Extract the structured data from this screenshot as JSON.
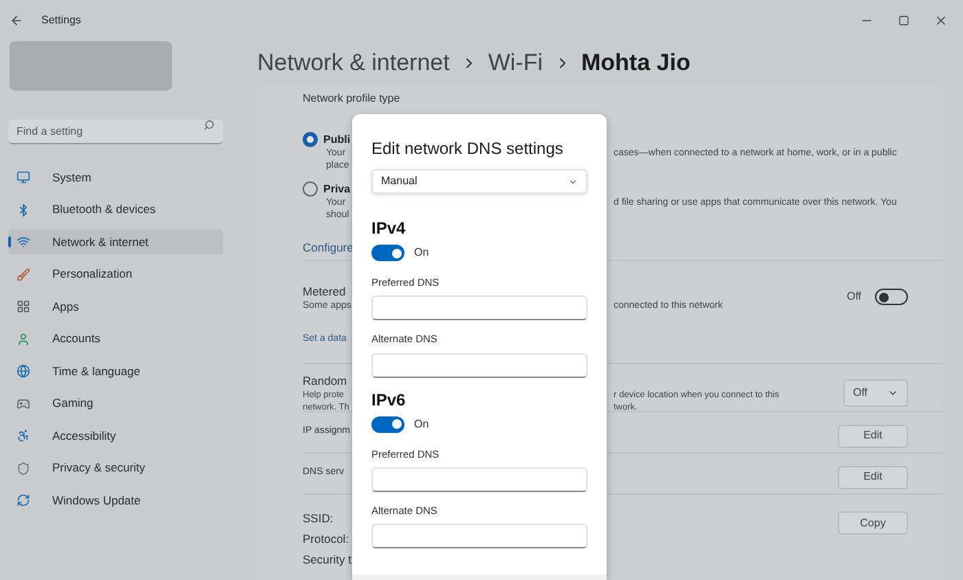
{
  "window": {
    "title": "Settings"
  },
  "breadcrumb": [
    {
      "label": "Network & internet",
      "current": false
    },
    {
      "label": "Wi-Fi",
      "current": false
    },
    {
      "label": "Mohta Jio",
      "current": true
    }
  ],
  "search": {
    "placeholder": "Find a setting"
  },
  "sidebar": {
    "items": [
      {
        "label": "System",
        "selected": false
      },
      {
        "label": "Bluetooth & devices",
        "selected": false
      },
      {
        "label": "Network & internet",
        "selected": true
      },
      {
        "label": "Personalization",
        "selected": false
      },
      {
        "label": "Apps",
        "selected": false
      },
      {
        "label": "Accounts",
        "selected": false
      },
      {
        "label": "Time & language",
        "selected": false
      },
      {
        "label": "Gaming",
        "selected": false
      },
      {
        "label": "Accessibility",
        "selected": false
      },
      {
        "label": "Privacy & security",
        "selected": false
      },
      {
        "label": "Windows Update",
        "selected": false
      }
    ]
  },
  "profile_section": {
    "heading": "Network profile type",
    "options": [
      {
        "label": "Publi",
        "line_1": "Your",
        "line_1_rest": "cases—when connected to a network at home, work, or in a public",
        "line_2": "place",
        "selected": true
      },
      {
        "label": "Priva",
        "line_1": "Your",
        "line_1_rest": "d file sharing or use apps that communicate over this network. You",
        "line_2": "shoul",
        "selected": false
      }
    ],
    "link": "Configure"
  },
  "metered": {
    "title": "Metered",
    "description": "Some apps",
    "description_rest": "connected to this network",
    "link": "Set a data",
    "toggle_label": "Off",
    "on": false
  },
  "random": {
    "title": "Random",
    "line_1": "Help prote",
    "line_1_rest": "r device location when you connect to this",
    "line_2": "network. Th",
    "line_2_rest": "twork.",
    "value": "Off"
  },
  "ip_assignment": {
    "title": "IP assignm",
    "button": "Edit"
  },
  "dns_server": {
    "title": "DNS serv",
    "button": "Edit"
  },
  "properties": {
    "labels": [
      "SSID:",
      "Protocol:",
      "Security t"
    ],
    "button": "Copy"
  },
  "dialog": {
    "title": "Edit network DNS settings",
    "mode": "Manual",
    "sections": [
      {
        "heading": "IPv4",
        "on": true,
        "toggle_label": "On",
        "fields": [
          {
            "label": "Preferred DNS"
          },
          {
            "label": "Alternate DNS"
          }
        ]
      },
      {
        "heading": "IPv6",
        "on": true,
        "toggle_label": "On",
        "fields": [
          {
            "label": "Preferred DNS"
          },
          {
            "label": "Alternate DNS"
          }
        ]
      }
    ]
  }
}
